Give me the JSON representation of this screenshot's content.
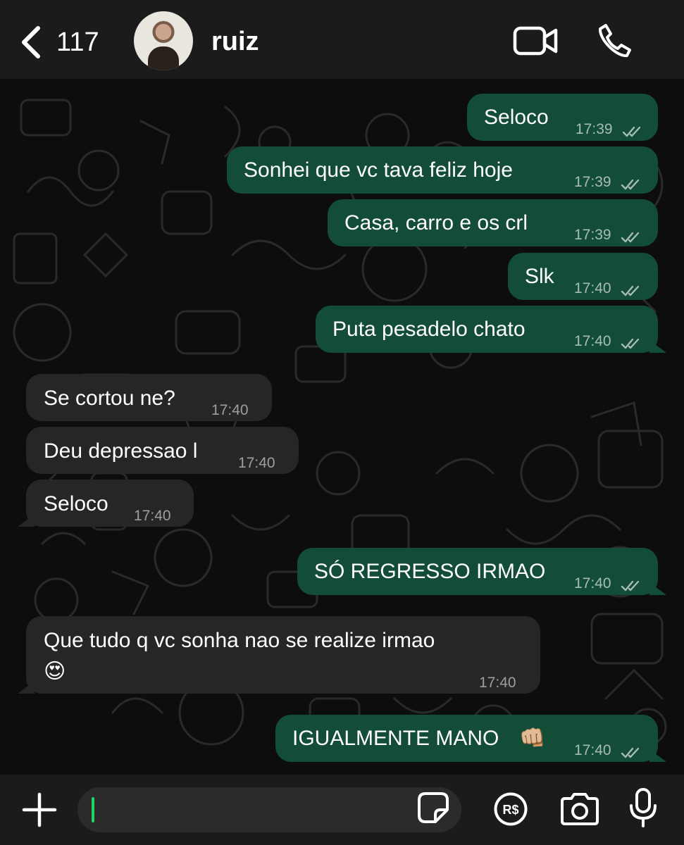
{
  "header": {
    "back_count": "117",
    "contact_name": "ruiz",
    "back_icon": "chevron-left-icon",
    "video_icon": "video-camera-icon",
    "call_icon": "phone-icon"
  },
  "messages": [
    {
      "dir": "out",
      "text": "Seloco",
      "time": "17:39",
      "status": "read"
    },
    {
      "dir": "out",
      "text": "Sonhei que vc tava feliz hoje",
      "time": "17:39",
      "status": "read"
    },
    {
      "dir": "out",
      "text": "Casa, carro e os crl",
      "time": "17:39",
      "status": "read"
    },
    {
      "dir": "out",
      "text": "Slk",
      "time": "17:40",
      "status": "read"
    },
    {
      "dir": "out",
      "text": "Puta pesadelo chato",
      "time": "17:40",
      "status": "read"
    },
    {
      "dir": "in",
      "text": "Se cortou ne?",
      "time": "17:40"
    },
    {
      "dir": "in",
      "text": "Deu depressao l",
      "time": "17:40"
    },
    {
      "dir": "in",
      "text": "Seloco",
      "time": "17:40"
    },
    {
      "dir": "out",
      "text": "SÓ REGRESSO IRMAO",
      "time": "17:40",
      "status": "read"
    },
    {
      "dir": "in",
      "text": "Que tudo q vc sonha nao se realize irmao",
      "emoji": "😍",
      "time": "17:40"
    },
    {
      "dir": "out",
      "text": "IGUALMENTE MANO",
      "emoji": "👊🏼",
      "time": "17:40",
      "status": "read"
    }
  ],
  "composer": {
    "input_value": "",
    "plus_icon": "plus-icon",
    "sticker_icon": "sticker-icon",
    "payment_icon": "payment-icon",
    "payment_label": "R$",
    "camera_icon": "camera-icon",
    "mic_icon": "microphone-icon"
  },
  "colors": {
    "outgoing_bubble": "#134d37",
    "incoming_bubble": "#262628",
    "header_bg": "#1b1b1b",
    "chat_bg": "#0d0d0d",
    "caret": "#25d366"
  }
}
